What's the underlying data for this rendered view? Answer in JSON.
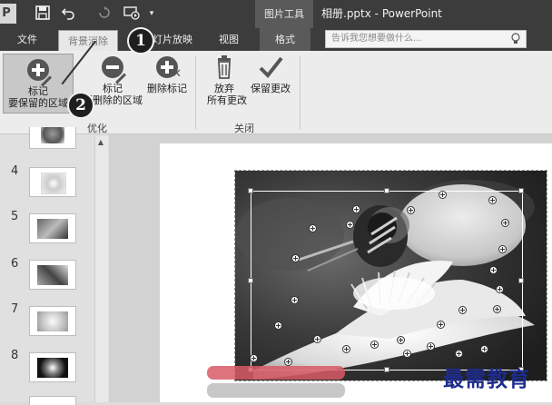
{
  "titlebar": {
    "file_badge": "P",
    "context_group": "图片工具",
    "window_title": "相册.pptx - PowerPoint"
  },
  "tabs": {
    "file": "文件",
    "remove_background": "背景消除",
    "slideshow": "灯片放映",
    "view": "视图",
    "format": "格式"
  },
  "tellme": {
    "placeholder": "告诉我您想要做什么..."
  },
  "ribbon": {
    "keep_line1": "标记",
    "keep_line2": "要保留的区域",
    "remove_line1": "标记",
    "remove_line2": "要删除的区域",
    "delete_mark": "删除标记",
    "discard_line1": "放弃",
    "discard_line2": "所有更改",
    "keep_changes": "保留更改",
    "group_refine": "优化",
    "group_close": "关闭"
  },
  "callouts": {
    "step1": "1",
    "step2": "2"
  },
  "slides": [
    {
      "num": "4"
    },
    {
      "num": "5"
    },
    {
      "num": "6"
    },
    {
      "num": "7"
    },
    {
      "num": "8"
    }
  ],
  "watermark": "最需教育",
  "colors": {
    "title_bar": "#3c3c3c",
    "ribbon": "#ececec",
    "watermark": "#1d2c8c"
  }
}
